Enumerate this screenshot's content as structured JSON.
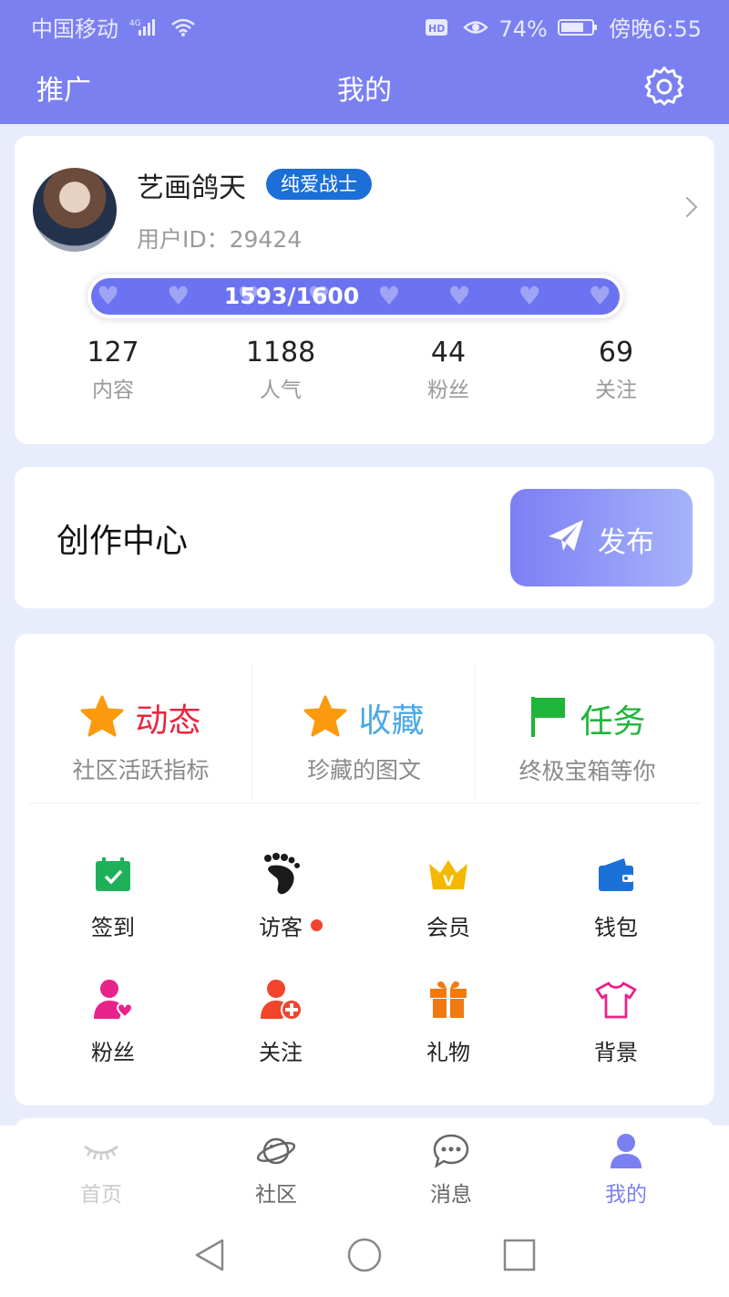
{
  "status_bar": {
    "carrier": "中国移动",
    "network": "4G",
    "battery": "74%",
    "time": "傍晚6:55"
  },
  "appbar": {
    "left": "推广",
    "title": "我的"
  },
  "profile": {
    "name": "艺画鸽天",
    "badge": "纯爱战士",
    "user_id": "用户ID：29424",
    "level_text": "1593/1600",
    "level_progress": 0.9956,
    "stats": [
      {
        "value": "127",
        "label": "内容"
      },
      {
        "value": "1188",
        "label": "人气"
      },
      {
        "value": "44",
        "label": "粉丝"
      },
      {
        "value": "69",
        "label": "关注"
      }
    ]
  },
  "creator": {
    "label": "创作中心",
    "publish": "发布"
  },
  "features": [
    {
      "title": "动态",
      "subtitle": "社区活跃指标",
      "color": "#e8263f",
      "icon": "star-icon"
    },
    {
      "title": "收藏",
      "subtitle": "珍藏的图文",
      "color": "#4aa8e8",
      "icon": "star-icon"
    },
    {
      "title": "任务",
      "subtitle": "终极宝箱等你",
      "color": "#1fb53a",
      "icon": "flag-icon"
    }
  ],
  "grid": [
    {
      "label": "签到",
      "icon": "calendar-check-icon",
      "color": "#1fb05a"
    },
    {
      "label": "访客",
      "icon": "footprints-icon",
      "color": "#1a1a1a",
      "dot": true
    },
    {
      "label": "会员",
      "icon": "crown-icon",
      "color": "#f5b800"
    },
    {
      "label": "钱包",
      "icon": "wallet-icon",
      "color": "#1a72d8"
    },
    {
      "label": "粉丝",
      "icon": "user-heart-icon",
      "color": "#e8238a"
    },
    {
      "label": "关注",
      "icon": "user-add-icon",
      "color": "#f0442b"
    },
    {
      "label": "礼物",
      "icon": "gift-icon",
      "color": "#f07a10"
    },
    {
      "label": "背景",
      "icon": "tshirt-icon",
      "color": "#e8238a"
    }
  ],
  "tabs": [
    {
      "label": "首页",
      "icon": "eye-lashes-icon",
      "active": false
    },
    {
      "label": "社区",
      "icon": "planet-icon",
      "active": false
    },
    {
      "label": "消息",
      "icon": "chat-icon",
      "active": false
    },
    {
      "label": "我的",
      "icon": "user-icon",
      "active": true
    }
  ],
  "colors": {
    "primary": "#7b80f1",
    "background": "#e8ecfb",
    "tab_active": "#7b80f1",
    "tab_inactive": "#666666",
    "tab_faded": "#cccccc"
  }
}
